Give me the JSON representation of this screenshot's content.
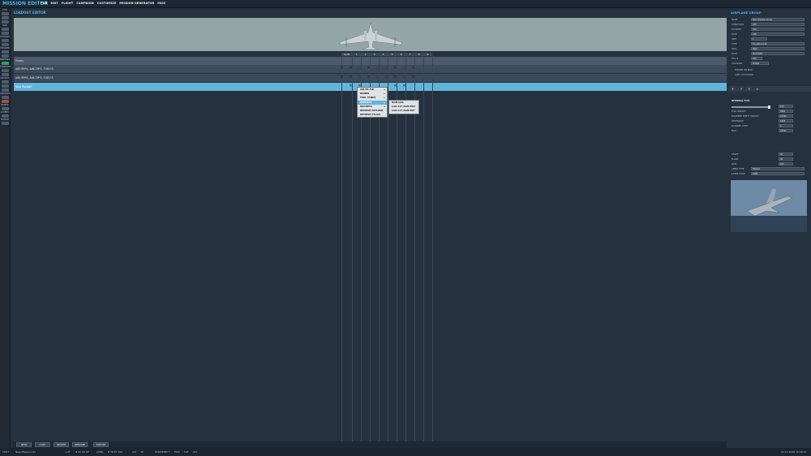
{
  "app": {
    "logo": "MISSION EDITOR"
  },
  "menu": [
    "FILE",
    "EDIT",
    "FLIGHT",
    "CAMPAIGN",
    "CUSTOMIZE",
    "MISSION GENERATOR",
    "MISC"
  ],
  "left_tools": {
    "file": "FILE",
    "groups": [
      "MAP",
      "OPTIONS",
      "TRIGGER",
      "BRIEFING",
      "TEMPLATE",
      "GROUPS",
      "AIRPORTS",
      "ZONES",
      "LAYERS",
      "EDITOR"
    ]
  },
  "loadout": {
    "title": "LOADOUT EDITOR",
    "columns": [
      "GUN",
      "1",
      "2",
      "3",
      "4",
      "5",
      "6",
      "7",
      "8",
      "9"
    ],
    "rows": [
      "Empty",
      "AIM-9M*4, AIM-7M*2, FUEL*3",
      "AIM-9M*4, AIM-7M*2, FUEL*3",
      "New Payload"
    ]
  },
  "context_menu": {
    "items": [
      {
        "label": "AIR-TO-AIR",
        "submenu": true
      },
      {
        "label": "BOMBS",
        "submenu": true
      },
      {
        "label": "FUEL TANKS",
        "submenu": true
      },
      {
        "label": "MISSILES",
        "submenu": true,
        "selected": true
      },
      {
        "label": "ROCKETS",
        "submenu": true
      },
      {
        "label": "REMOVE PAYLOAD",
        "submenu": false
      },
      {
        "label": "REMOVE PYLON",
        "submenu": false
      }
    ],
    "submenu": [
      "NON-GAS",
      "LAU-117,AGM-65D",
      "LAU-117,AGM-65F"
    ]
  },
  "bottom_buttons": [
    "NEW",
    "COPY",
    "DELETE",
    "RENAME",
    "EXPORT"
  ],
  "status": {
    "mode": "SPLIT",
    "mission": "New Mission.miz",
    "lat_label": "LAT",
    "lat": "N 42 44 42'",
    "long_label": "LONG",
    "long": "E 36 27 100",
    "alt_label": "ALT",
    "alt": "30",
    "pan_label": "PAN/SELECT",
    "map_modes": [
      "MAP",
      "SAT",
      "ALT"
    ],
    "datetime": "20.11.2016 16:00:21"
  },
  "right_panel": {
    "title": "AIRPLANE GROUP",
    "fields": [
      {
        "label": "NAME",
        "value": "New Airplane Group"
      },
      {
        "label": "CONDITION",
        "value": "100"
      },
      {
        "label": "COUNTRY",
        "value": "USA"
      },
      {
        "label": "TASK",
        "value": "CAP"
      },
      {
        "label": "UNIT",
        "value": "1"
      },
      {
        "label": "TYPE",
        "value": "F/A-18C Lot 20"
      },
      {
        "label": "SKILL",
        "value": "High"
      },
      {
        "label": "PILOT",
        "value": "Pilot #001"
      },
      {
        "label": "TAIL #",
        "value": "300"
      },
      {
        "label": "CALLSIGN",
        "value": "Enfield"
      }
    ],
    "checkboxes": [
      "HIDDEN ON MAP",
      "LATE ACTIVATION"
    ],
    "fuel": {
      "title": "INTERNAL FUEL",
      "percent": 100,
      "rows": [
        {
          "label": "FUEL WEIGHT",
          "value": "4900"
        },
        {
          "label": "EQUIPPED EMPTY WEIGHT",
          "value": "10890"
        },
        {
          "label": "ORDNANCE",
          "value": "1828"
        },
        {
          "label": "PLANNED COST",
          "value": "0"
        },
        {
          "label": "MAX",
          "value": "23541"
        }
      ]
    },
    "misc": [
      {
        "label": "CHAFF",
        "value": "60"
      },
      {
        "label": "FLARE",
        "value": "30"
      },
      {
        "label": "GUN",
        "value": "100"
      },
      {
        "label": "AMMO TYPE",
        "value": "Default"
      },
      {
        "label": "LASER CODE",
        "value": "1688"
      }
    ]
  }
}
